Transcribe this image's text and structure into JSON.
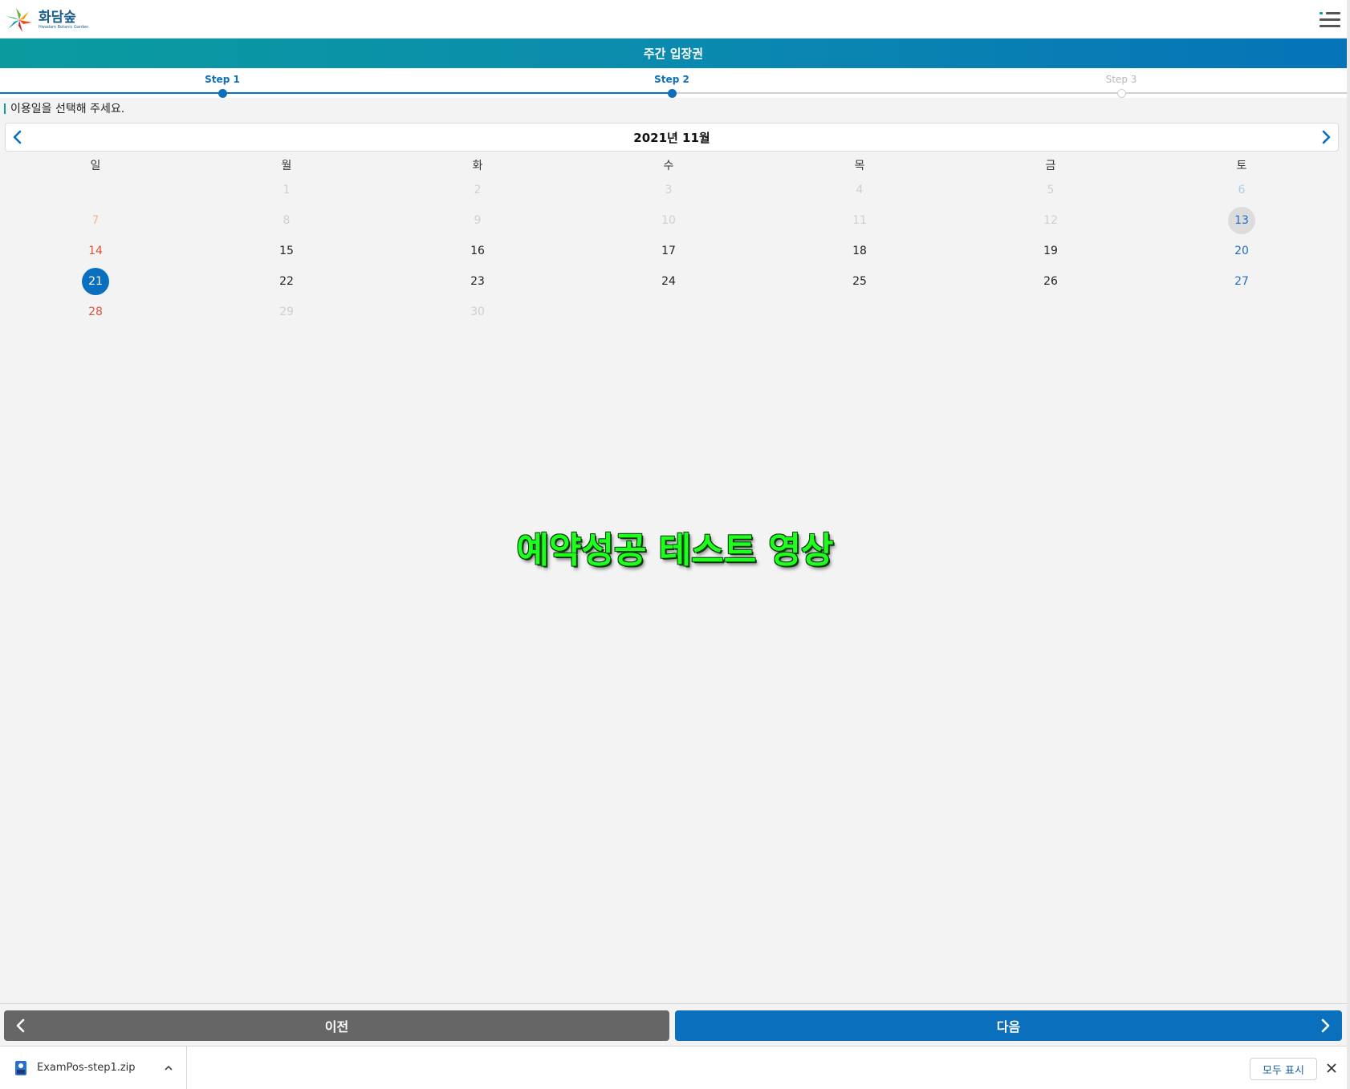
{
  "header": {
    "logo_name": "화담숲",
    "logo_sub": "Hwadam Botanic Garden",
    "menu_icon": "hamburger-menu-icon"
  },
  "title": "주간 입장권",
  "steps": [
    {
      "label": "Step 1",
      "state": "done"
    },
    {
      "label": "Step 2",
      "state": "active"
    },
    {
      "label": "Step 3",
      "state": "inactive"
    }
  ],
  "instruction": "이용일을 선택해 주세요.",
  "calendar": {
    "month_title": "2021년 11월",
    "weekdays": [
      "일",
      "월",
      "화",
      "수",
      "목",
      "금",
      "토"
    ],
    "weeks": [
      [
        "",
        "1",
        "2",
        "3",
        "4",
        "5",
        "6"
      ],
      [
        "7",
        "8",
        "9",
        "10",
        "11",
        "12",
        "13"
      ],
      [
        "14",
        "15",
        "16",
        "17",
        "18",
        "19",
        "20"
      ],
      [
        "21",
        "22",
        "23",
        "24",
        "25",
        "26",
        "27"
      ],
      [
        "28",
        "29",
        "30",
        "",
        "",
        "",
        ""
      ]
    ],
    "today": "13",
    "selected": "21",
    "disabled": [
      "1",
      "2",
      "3",
      "4",
      "5",
      "6",
      "7",
      "8",
      "9",
      "10",
      "11",
      "12",
      "29",
      "30"
    ]
  },
  "overlay_text": "예약성공 테스트 영상",
  "buttons": {
    "prev_label": "이전",
    "next_label": "다음"
  },
  "download_bar": {
    "file_name": "ExamPos-step1.zip",
    "show_all_label": "모두 표시"
  },
  "colors": {
    "primary": "#0a6fbd",
    "teal": "#0a9b9e",
    "sunday": "#e0533d",
    "saturday": "#1e6fc0",
    "overlay_green": "#1dff1d"
  }
}
